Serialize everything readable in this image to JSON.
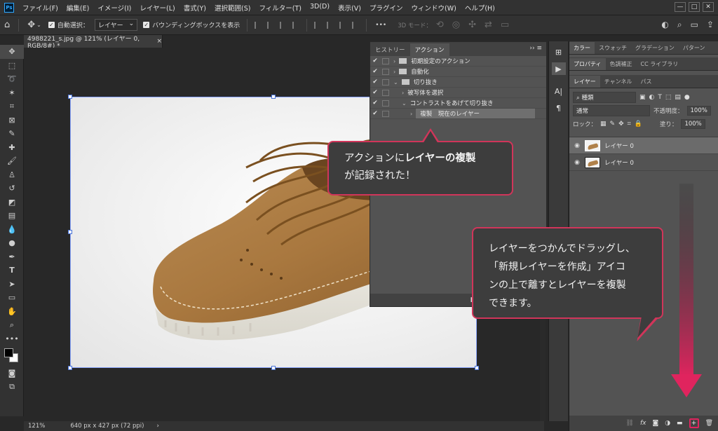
{
  "menubar": {
    "logo": "Ps",
    "items": [
      "ファイル(F)",
      "編集(E)",
      "イメージ(I)",
      "レイヤー(L)",
      "書式(Y)",
      "選択範囲(S)",
      "フィルター(T)",
      "3D(D)",
      "表示(V)",
      "プラグイン",
      "ウィンドウ(W)",
      "ヘルプ(H)"
    ],
    "window_controls": [
      "—",
      "□",
      "✕"
    ]
  },
  "options": {
    "auto_select_label": "自動選択：",
    "auto_select_value": "レイヤー",
    "bounding_box_label": "バウンディングボックスを表示",
    "more": "•••",
    "mode3d_label": "3D モード："
  },
  "document": {
    "tab_title": "4988221_s.jpg @ 121% (レイヤー 0, RGB/8#) *",
    "tab_close": "×",
    "zoom": "121%",
    "doc_info": "640 px x 427 px (72 ppi)",
    "status_arrow": "›"
  },
  "actions_panel": {
    "tabs": [
      "ヒストリー",
      "アクション"
    ],
    "rows": [
      {
        "check": "✔",
        "indent": 0,
        "expand": "›",
        "folder": true,
        "label": "初期設定のアクション"
      },
      {
        "check": "✔",
        "indent": 0,
        "expand": "›",
        "folder": true,
        "label": "自動化"
      },
      {
        "check": "✔",
        "indent": 0,
        "expand": "⌄",
        "folder": true,
        "label": "切り抜き"
      },
      {
        "check": "✔",
        "indent": 1,
        "expand": "›",
        "folder": false,
        "label": "被写体を選択"
      },
      {
        "check": "✔",
        "indent": 1,
        "expand": "⌄",
        "folder": false,
        "label": "コントラストをあげて切り抜き"
      },
      {
        "check": "✔",
        "indent": 2,
        "expand": "›",
        "folder": false,
        "label": "複製　現在のレイヤー",
        "selected": true
      }
    ],
    "bottom_stop": "■",
    "bottom_record": "●"
  },
  "right_panel": {
    "tabs_top": [
      "カラー",
      "スウォッチ",
      "グラデーション",
      "パターン"
    ],
    "tabs_mid": [
      "プロパティ",
      "色調補正",
      "CC ライブラリ"
    ],
    "tabs_layers": [
      "レイヤー",
      "チャンネル",
      "パス"
    ],
    "filter_label": "種類",
    "blend_mode": "通常",
    "opacity_label": "不透明度：",
    "opacity_value": "100%",
    "lock_label": "ロック：",
    "fill_label": "塗り：",
    "fill_value": "100%",
    "layers": [
      {
        "name": "レイヤー 0",
        "selected": true
      },
      {
        "name": "レイヤー 0",
        "selected": false
      }
    ],
    "bottom_icons": [
      "GO",
      "fx",
      "◘",
      "◑",
      "▬",
      "⊞",
      "🗑"
    ]
  },
  "callouts": {
    "c1_line1_a": "アクションに",
    "c1_line1_b": "レイヤーの複製",
    "c1_line2": "が記録された！",
    "c2_line1": "レイヤーをつかんでドラッグし、",
    "c2_line2": "「新規レイヤーを作成」アイコ",
    "c2_line3": "ンの上で離すとレイヤーを複製",
    "c2_line4": "できます。"
  },
  "colors": {
    "accent": "#d1355a",
    "arrow_gradient_top": "#2b2b2b",
    "arrow_gradient_bottom": "#e0245e",
    "ui_dark": "#323232",
    "panel": "#535353"
  }
}
